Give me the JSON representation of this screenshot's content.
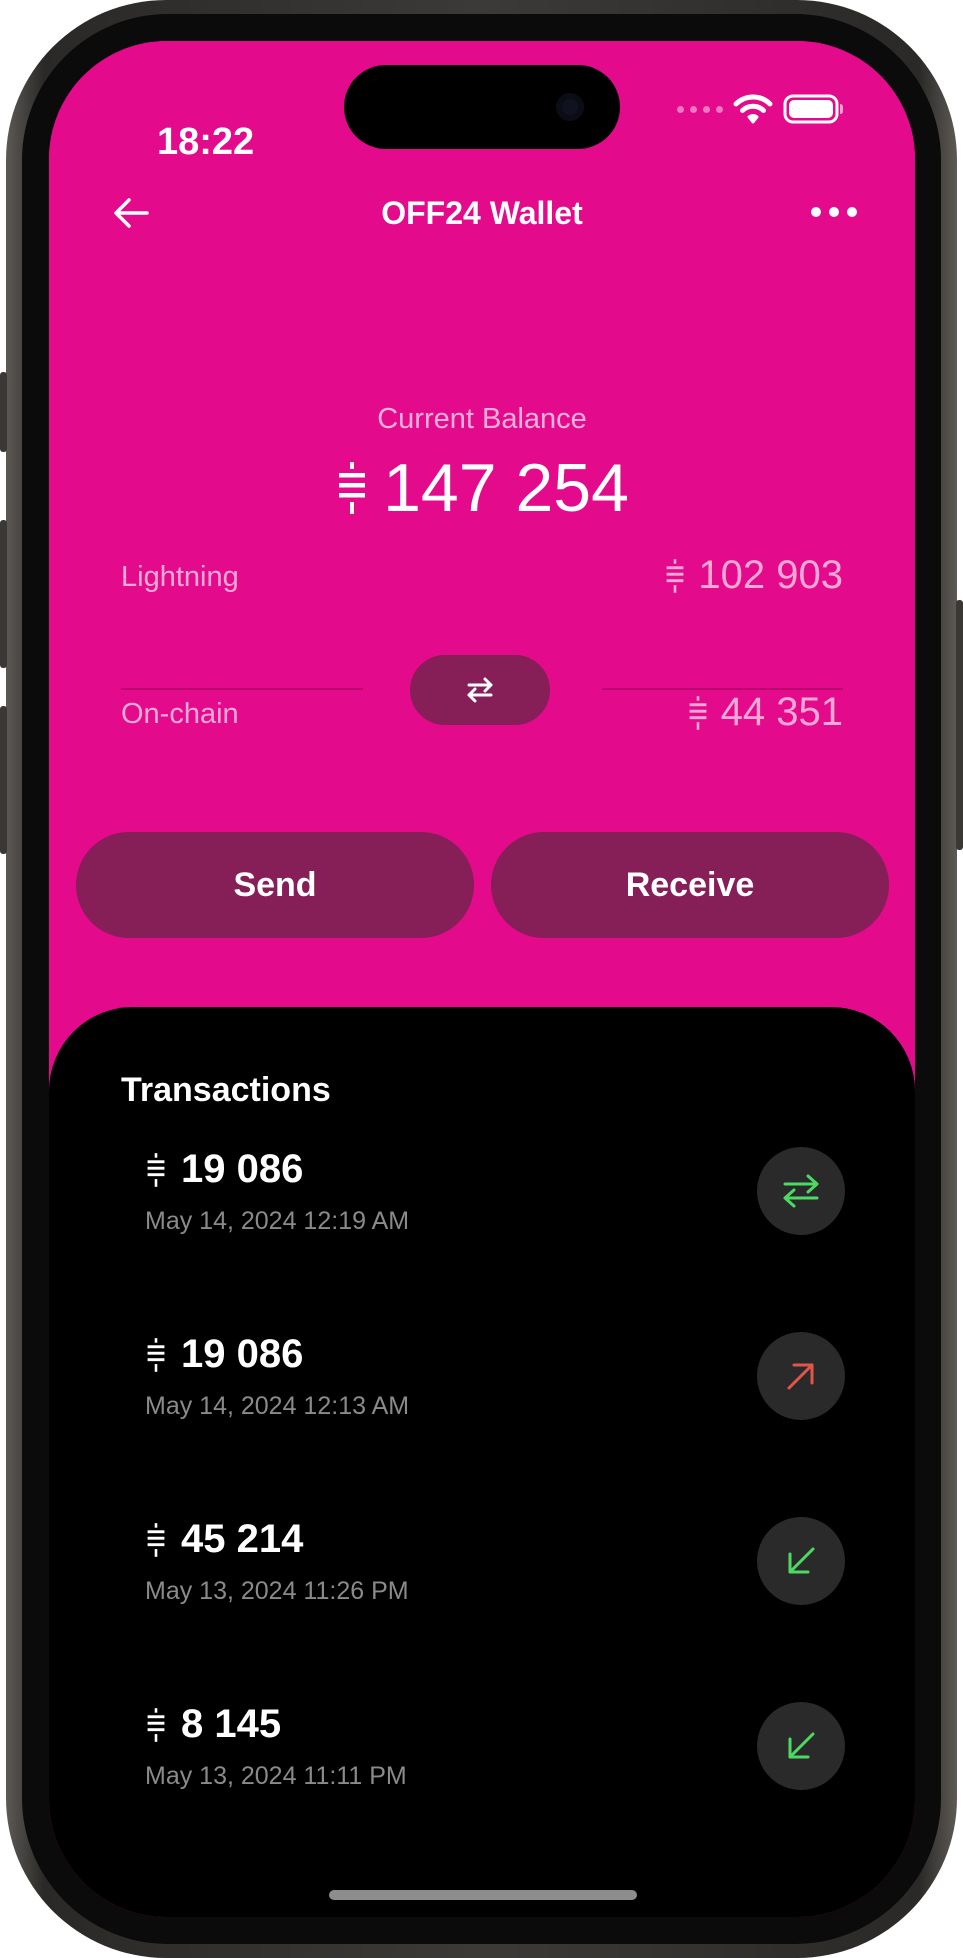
{
  "status_bar": {
    "time": "18:22"
  },
  "header": {
    "title": "OFF24 Wallet"
  },
  "balance": {
    "label": "Current Balance",
    "amount": "147 254"
  },
  "lightning": {
    "label": "Lightning",
    "amount": "102 903"
  },
  "onchain": {
    "label": "On-chain",
    "amount": "44 351"
  },
  "actions": {
    "send": "Send",
    "receive": "Receive"
  },
  "transactions": {
    "title": "Transactions",
    "items": [
      {
        "amount": "19 086",
        "date": "May 14, 2024 12:19 AM",
        "type": "swap-icon",
        "color": "#4cd964"
      },
      {
        "amount": "19 086",
        "date": "May 14, 2024 12:13 AM",
        "type": "arrow-up-right-icon",
        "color": "#e0574a"
      },
      {
        "amount": "45 214",
        "date": "May 13, 2024 11:26 PM",
        "type": "arrow-down-left-icon",
        "color": "#4cd964"
      },
      {
        "amount": "8 145",
        "date": "May 13, 2024 11:11 PM",
        "type": "arrow-down-left-icon",
        "color": "#4cd964"
      }
    ]
  },
  "colors": {
    "accent": "#e30a8c",
    "button": "#861e57",
    "incoming": "#4cd964",
    "outgoing": "#e0574a"
  }
}
